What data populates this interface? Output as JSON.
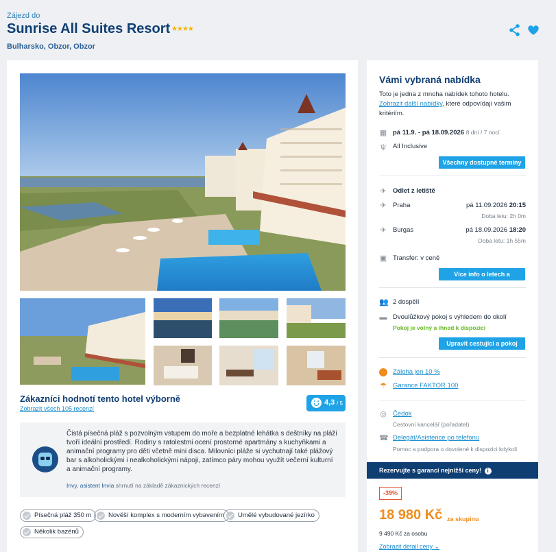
{
  "header": {
    "eyebrow": "Zájezd do",
    "title": "Sunrise All Suites Resort",
    "stars": "★★★★",
    "location": "Bulharsko, Obzor, Obzor"
  },
  "reviews": {
    "title": "Zákazníci hodnotí tento hotel výborně",
    "link": "Zobrazit všech 105 recenzí",
    "score": "4,3",
    "score_max": "/ 5"
  },
  "ai_summary": {
    "text": "Čistá písečná pláž s pozvolným vstupem do moře a bezplatné lehátka s deštníky na pláži tvoří ideální prostředí. Rodiny s ratolestmi ocení prostorné apartmány s kuchyňkami a animační programy pro děti včetně mini disca. Milovníci pláže si vychutnají také plážový bar s alkoholickými i nealkoholickými nápoji, zatímco páry mohou využít večerní kulturní a animační programy.",
    "author": "Invy, asistent Invia",
    "note": "shrnutí na základě zákaznických recenzí"
  },
  "tags": [
    "Písečná pláž 350 m",
    "Nověší komplex s moderním vybavením",
    "Umělé vybudované jezírko",
    "Několik bazénů"
  ],
  "offer": {
    "title": "Vámi vybraná nabídka",
    "intro_1": "Toto je jedna z mnoha nabídek tohoto hotelu.",
    "intro_link": "Zobrazit další nabídky",
    "intro_2": ", které odpovídají vašim kritériím.",
    "dates": "pá 11.9. - pá 18.09.2026",
    "duration": "8 dní / 7 nocí",
    "board": "All Inclusive",
    "btn_dates": "Všechny dostupné termíny",
    "departure_label": "Odlet z letiště",
    "out_city": "Praha",
    "out_date": "pá 11.09.2026",
    "out_time": "20:15",
    "out_duration": "Doba letu: 2h 0m",
    "in_city": "Burgas",
    "in_date": "pá 18.09.2026",
    "in_time": "18:20",
    "in_duration": "Doba letu: 1h 55m",
    "transfer": "Transfer: v ceně",
    "btn_flights": "Více info o letech a alternativy",
    "persons": "2 dospělí",
    "room": "Dvoulůžkový pokoj s výhledem do okolí",
    "availability": "Pokoj je volný a ihned k dispozici",
    "btn_room": "Upravit cestující a pokoj",
    "deposit": "Záloha jen 10 %",
    "guarantee": "Garance FAKTOR 100",
    "agency": "Čedok",
    "agency_sub": "Cestovní kancelář (pořadatel)",
    "delegate": "Delegát/Asistence po telefonu",
    "delegate_sub": "Pomoc a podpora o dovolené k dispozici kdykoli",
    "banner": "Rezervujte s garancí nejnižší ceny!",
    "discount": "-39%",
    "price": "18 980 Kč",
    "price_unit": "za skupinu",
    "per_person": "9 490 Kč",
    "per_person_label": "za osobu",
    "detail_link": "Zobrazit detail ceny"
  },
  "colors": {
    "accent": "#1fa3e6",
    "navy": "#0f3e73",
    "orange": "#f08c1e",
    "green": "#66b821"
  }
}
